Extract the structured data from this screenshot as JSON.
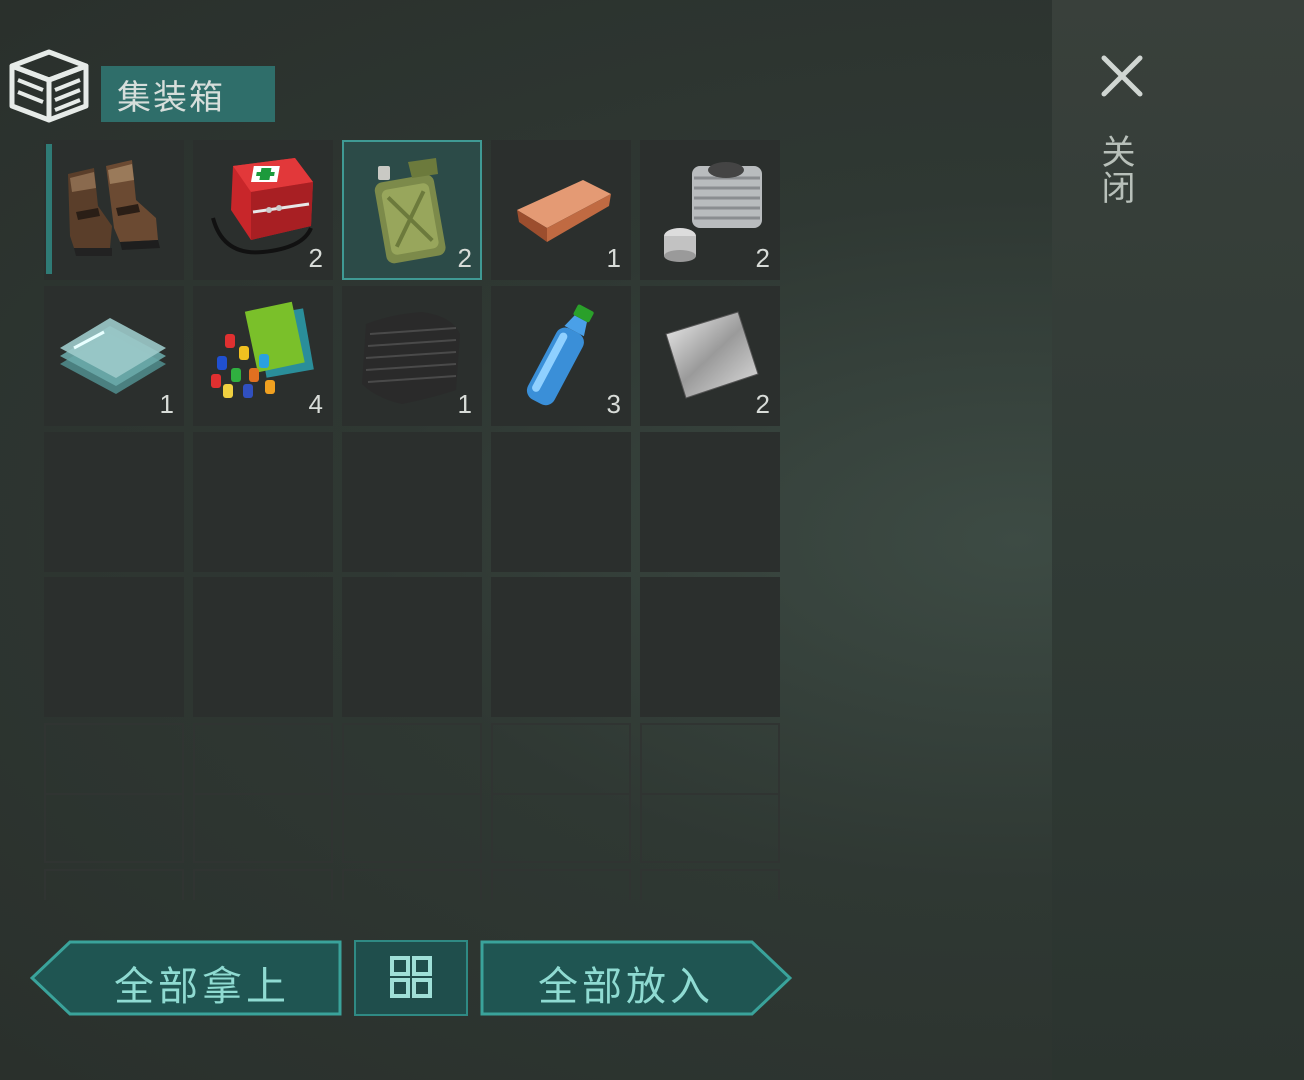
{
  "container": {
    "title": "集装箱"
  },
  "close": {
    "label": "关闭"
  },
  "slots": [
    {
      "item": "boots-icon",
      "qty": ""
    },
    {
      "item": "first-aid-kit-icon",
      "qty": "2"
    },
    {
      "item": "jerry-can-icon",
      "qty": "2"
    },
    {
      "item": "copper-ingot-icon",
      "qty": "1"
    },
    {
      "item": "engine-cylinder-icon",
      "qty": "2"
    },
    {
      "item": "glass-panes-icon",
      "qty": "1"
    },
    {
      "item": "electronic-parts-icon",
      "qty": "4"
    },
    {
      "item": "carbon-fabric-icon",
      "qty": "1"
    },
    {
      "item": "water-bottle-icon",
      "qty": "3"
    },
    {
      "item": "metal-sheet-icon",
      "qty": "2"
    }
  ],
  "buttons": {
    "take_all": "全部拿上",
    "put_all": "全部放入",
    "sort_icon": "sort-grid-icon"
  },
  "colors": {
    "accent": "#2f8a84",
    "button_text": "#8fdbd2",
    "title_bg": "#2f6e6a"
  }
}
